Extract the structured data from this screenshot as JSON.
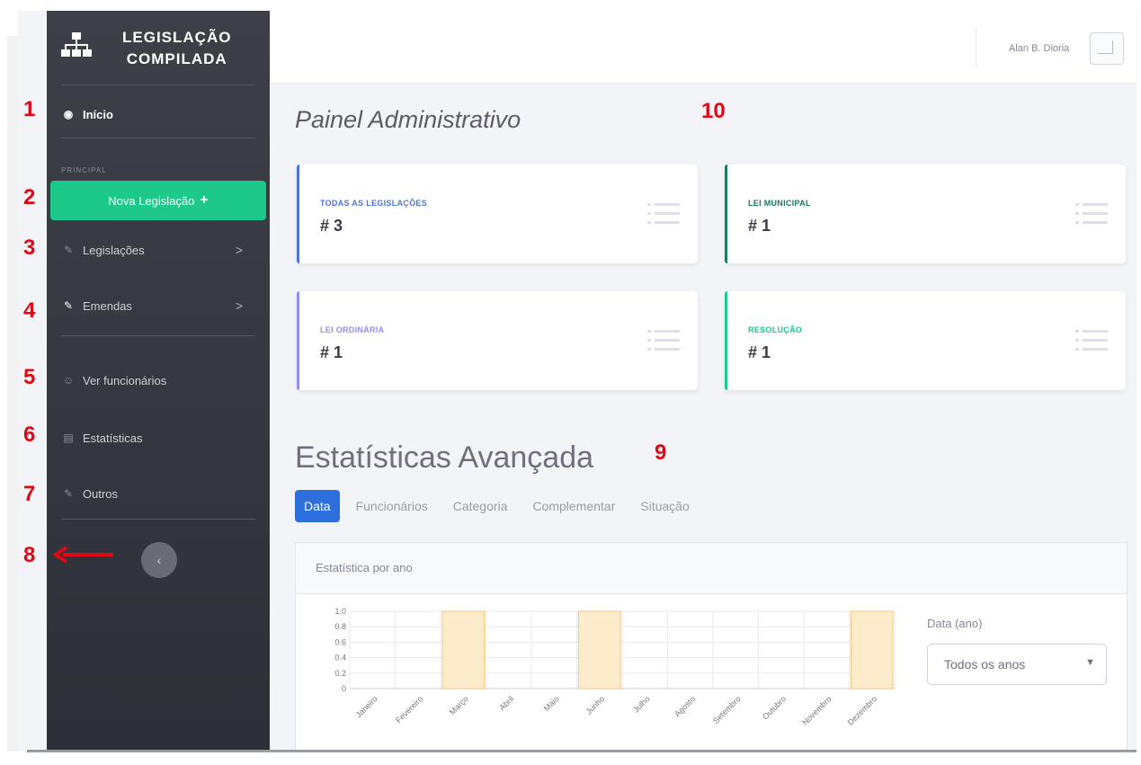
{
  "brand": {
    "line1": "LEGISLAÇÃO",
    "line2": "COMPILADA"
  },
  "sidebar": {
    "home": "Início",
    "section": "PRINCIPAL",
    "new_button": "Nova Legislação",
    "new_button_icon": "+",
    "items": [
      {
        "label": "Legislações",
        "icon": "wrench-icon",
        "chevron": ">"
      },
      {
        "label": "Emendas",
        "icon": "edit-icon",
        "chevron": ">"
      },
      {
        "label": "Ver funcionários",
        "icon": "users-icon"
      },
      {
        "label": "Estatísticas",
        "icon": "chart-icon"
      },
      {
        "label": "Outros",
        "icon": "edit-icon"
      }
    ],
    "toggle_glyph": "‹"
  },
  "annotations": [
    "1",
    "2",
    "3",
    "4",
    "5",
    "6",
    "7",
    "8",
    "9",
    "10"
  ],
  "topbar": {
    "user_name": "Alan B. Dioria"
  },
  "page_title": "Painel Administrativo",
  "cards": [
    {
      "label": "TODAS AS LEGISLAÇÕES",
      "value": "# 3",
      "color": "#4e73df"
    },
    {
      "label": "LEI MUNICIPAL",
      "value": "# 1",
      "color": "#1a7a5a"
    },
    {
      "label": "LEI ORDINÁRIA",
      "value": "# 1",
      "color": "#8f8ff2"
    },
    {
      "label": "RESOLUÇÃO",
      "value": "# 1",
      "color": "#1cc88a"
    }
  ],
  "stats_title": "Estatísticas Avançada",
  "tabs": [
    "Data",
    "Funcionários",
    "Categoria",
    "Complementar",
    "Situação"
  ],
  "panel_title": "Estatística por ano",
  "filter": {
    "label": "Data (ano)",
    "selected": "Todos os anos"
  },
  "chart_data": {
    "type": "bar",
    "categories": [
      "Janeiro",
      "Fevereiro",
      "Março",
      "Abril",
      "Maio",
      "Junho",
      "Julho",
      "Agosto",
      "Setembro",
      "Outubro",
      "Novembro",
      "Dezembro"
    ],
    "values": [
      0,
      0,
      1,
      0,
      0,
      1,
      0,
      0,
      0,
      0,
      0,
      1
    ],
    "yticks": [
      "0",
      "0.2",
      "0.4",
      "0.6",
      "0.8",
      "1.0"
    ],
    "ylim": [
      0,
      1
    ],
    "grid": true,
    "bar_color": "#fdeccb",
    "bar_border": "#f6c77d"
  }
}
